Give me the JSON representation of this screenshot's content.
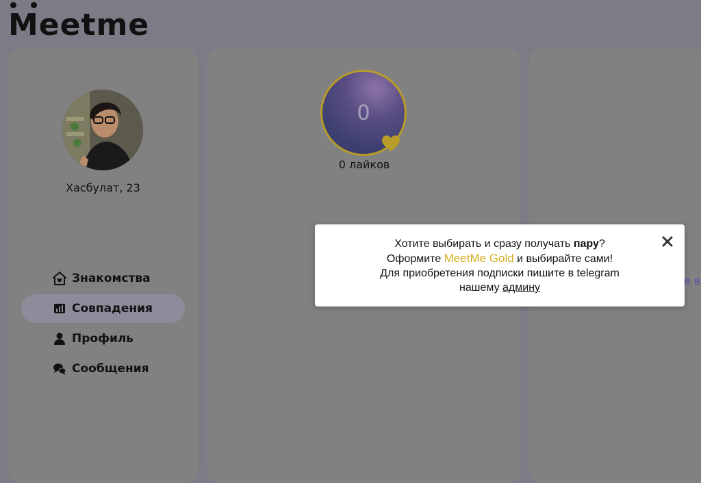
{
  "app": {
    "logo_text": "eetme",
    "logo_m": "M"
  },
  "user": {
    "name_age": "Хасбулат, 23"
  },
  "nav": {
    "items": [
      {
        "label": "Знакомства",
        "icon": "home-heart-icon",
        "active": false
      },
      {
        "label": "Совпадения",
        "icon": "chart-icon",
        "active": true
      },
      {
        "label": "Профиль",
        "icon": "user-icon",
        "active": false
      },
      {
        "label": "Сообщения",
        "icon": "chat-icon",
        "active": false
      }
    ]
  },
  "likes": {
    "count": "0",
    "label": "0 лайков"
  },
  "right_panel": {
    "snippet": "е в"
  },
  "modal": {
    "line1_pre": "Хотите выбирать и сразу получать ",
    "line1_bold": "пару",
    "line1_post": "?",
    "line2_pre": "Оформите ",
    "line2_gold": "MeetMe Gold",
    "line2_post": " и выбирайте сами!",
    "line3": "Для приобретения подписки пишите в telegram",
    "line4_pre": "нашему ",
    "line4_link": "админу"
  },
  "colors": {
    "gold": "#d5ad1d",
    "accent": "#5c50a6",
    "active_nav": "#8f8b9b"
  }
}
